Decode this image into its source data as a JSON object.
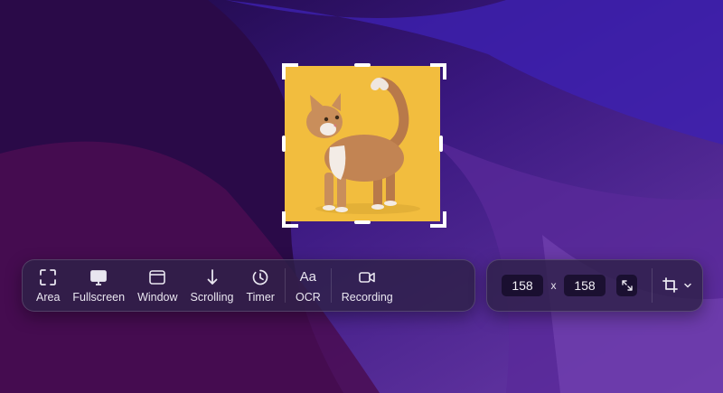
{
  "tools": {
    "area": "Area",
    "fullscreen": "Fullscreen",
    "window": "Window",
    "scrolling": "Scrolling",
    "timer": "Timer",
    "ocr_glyph": "Aa",
    "ocr": "OCR",
    "recording": "Recording"
  },
  "dimensions": {
    "width": "158",
    "separator": "x",
    "height": "158"
  },
  "icons": {
    "area": "area-select-icon",
    "fullscreen": "monitor-icon",
    "window": "window-icon",
    "scrolling": "arrow-down-icon",
    "timer": "timer-icon",
    "recording": "video-camera-icon",
    "aspect": "expand-arrows-icon",
    "crop": "crop-icon"
  },
  "colors": {
    "selection_background": "#f2bd3e",
    "panel": "#2e2148",
    "text": "#e9e6f0"
  }
}
